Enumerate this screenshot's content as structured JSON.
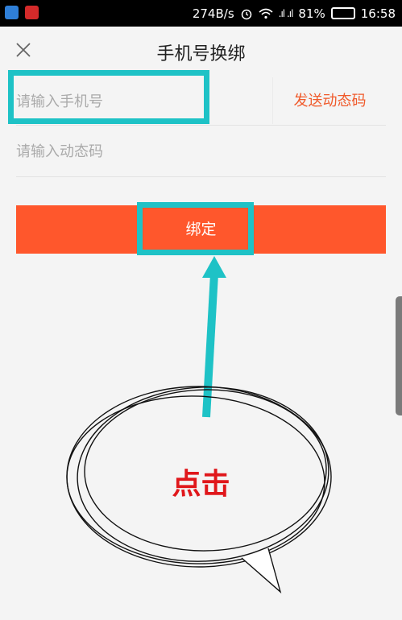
{
  "status_bar": {
    "net_speed": "274B/s",
    "signal": ".ıl .ıl",
    "battery_percent": "81%",
    "battery_level": 0.81,
    "time": "16:58"
  },
  "header": {
    "title": "手机号换绑"
  },
  "form": {
    "phone_placeholder": "请输入手机号",
    "send_code_label": "发送动态码",
    "code_placeholder": "请输入动态码",
    "bind_label": "绑定"
  },
  "annotation": {
    "callout_text": "点击"
  },
  "colors": {
    "accent": "#ff572c",
    "link": "#f05a2b",
    "highlight": "#1ec2c6",
    "callout_text": "#e0171b"
  }
}
